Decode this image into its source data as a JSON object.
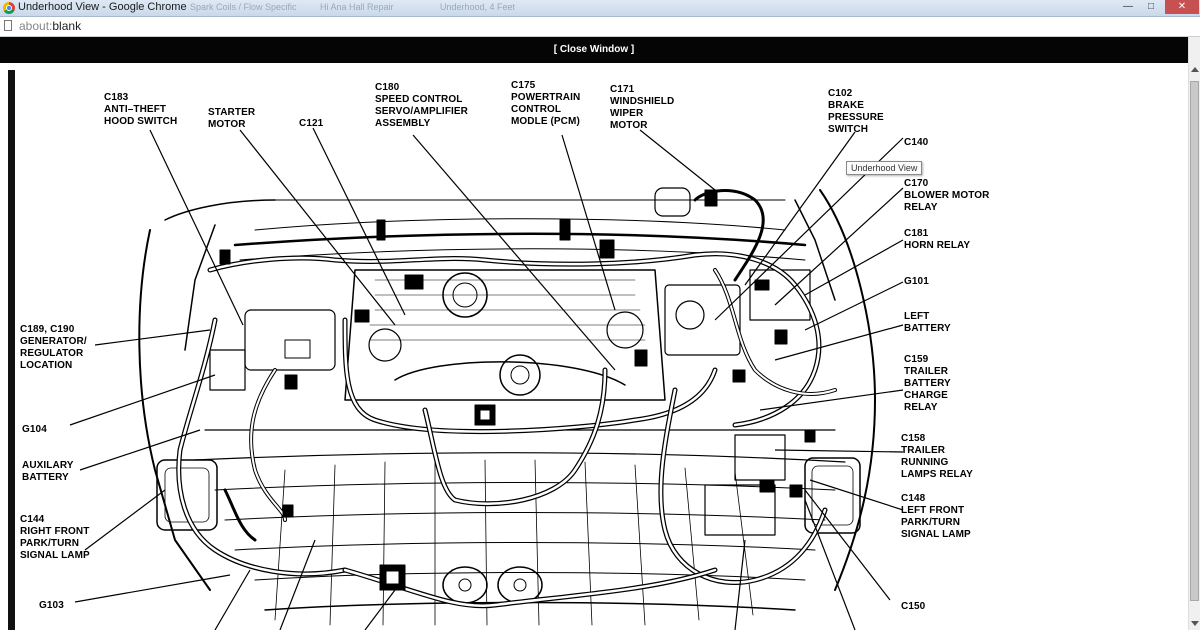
{
  "window": {
    "title": "Underhood View - Google Chrome",
    "background_tabs": [
      "Spark Coils / Flow Specific",
      "Hi Ana Hall Repair",
      "Underhood, 4 Feet"
    ],
    "minimize": "—",
    "maximize": "□",
    "close": "✕"
  },
  "address_bar": {
    "scheme": "about:",
    "path": "blank"
  },
  "header": {
    "close_window": "[ Close Window ]"
  },
  "tooltip": "Underhood View",
  "diagram": {
    "labels": {
      "c183": "C183\nANTI–THEFT\nHOOD SWITCH",
      "starter": "STARTER\nMOTOR",
      "c121": "C121",
      "c180": "C180\nSPEED CONTROL\nSERVO/AMPLIFIER\nASSEMBLY",
      "c175": "C175\nPOWERTRAIN\nCONTROL\nMODLE (PCM)",
      "c171": "C171\nWINDSHIELD\nWIPER\nMOTOR",
      "c102": "C102\nBRAKE\nPRESSURE\nSWITCH",
      "c140": "C140",
      "c170": "C170\nBLOWER MOTOR\nRELAY",
      "c181": "C181\nHORN RELAY",
      "g101": "G101",
      "left_battery": "LEFT\nBATTERY",
      "c159": "C159\nTRAILER\nBATTERY\nCHARGE\nRELAY",
      "c158": "C158\nTRAILER\nRUNNING\nLAMPS RELAY",
      "c148": "C148\nLEFT FRONT\nPARK/TURN\nSIGNAL LAMP",
      "c150": "C150",
      "c189": "C189, C190\nGENERATOR/\nREGULATOR\nLOCATION",
      "g104": "G104",
      "aux_battery": "AUXILARY\nBATTERY",
      "c144": "C144\nRIGHT FRONT\nPARK/TURN\nSIGNAL LAMP",
      "g103": "G103"
    }
  }
}
